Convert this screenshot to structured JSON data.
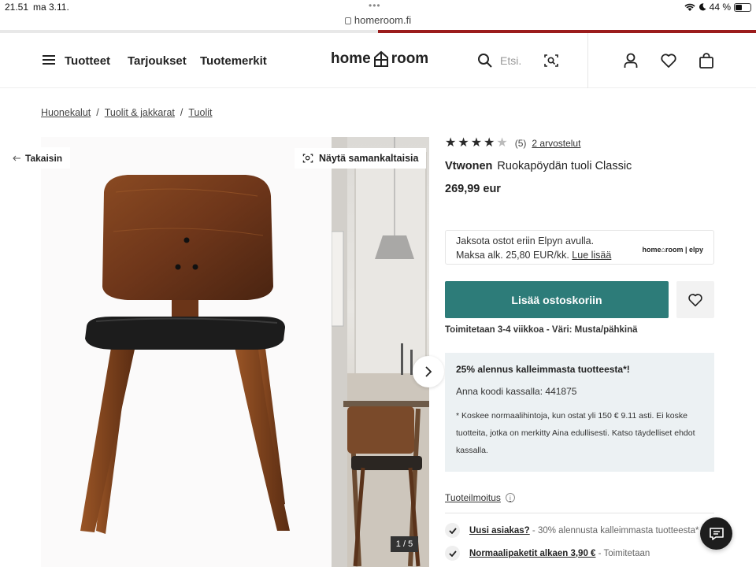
{
  "status_bar": {
    "time": "21.51",
    "date": "ma 3.11.",
    "dots": "•••",
    "url": "homeroom.fi",
    "battery": "44 %",
    "battery_level": 0.44,
    "page_load_progress": 0.5
  },
  "header": {
    "nav": [
      "Tuotteet",
      "Tarjoukset",
      "Tuotemerkit"
    ],
    "logo_left": "home",
    "logo_right": "room",
    "search_placeholder": "Etsi."
  },
  "breadcrumb": [
    "Huonekalut",
    "Tuolit & jakkarat",
    "Tuolit"
  ],
  "breadcrumb_separator": "/",
  "gallery": {
    "back_label": "Takaisin",
    "similar_label": "Näytä samankaltaisia",
    "counter": "1 / 5"
  },
  "product": {
    "rating": 4,
    "rating_max": 5,
    "rating_count": "(5)",
    "reviews_link": "2 arvostelut",
    "brand": "Vtwonen",
    "name": "Ruokapöydän tuoli Classic",
    "price": "269,99 eur"
  },
  "elpy": {
    "line1": "Jaksota ostot eriin Elpyn avulla.",
    "line2": "Maksa alk. 25,80 EUR/kk.",
    "link": "Lue lisää",
    "logo": "home⌂room | elpy"
  },
  "cart": {
    "add_label": "Lisää ostoskoriin"
  },
  "delivery": "Toimitetaan 3-4 viikkoa - Väri: Musta/pähkinä",
  "promo": {
    "title": "25% alennus kalleimmasta tuotteesta*!",
    "code": "Anna koodi kassalla: 441875",
    "note": "* Koskee normaalihintoja, kun ostat yli 150 € 9.11 asti. Ei koske tuotteita, jotka on merkitty Aina edullisesti. Katso täydelliset ehdot kassalla."
  },
  "product_info_link": "Tuoteilmoitus",
  "usps": [
    {
      "bold": "Uusi asiakas?",
      "text": " - 30% alennusta kalleimmasta tuotteesta*"
    },
    {
      "bold": "Normaalipaketit alkaen 3,90 €",
      "text": " - Toimitetaan"
    }
  ],
  "colors": {
    "accent": "#2d7c79",
    "progress": "#9b1c1c",
    "promo_bg": "#ecf1f3"
  }
}
